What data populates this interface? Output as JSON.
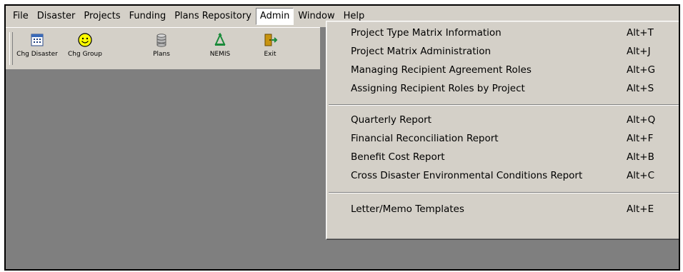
{
  "menubar": {
    "items": [
      "File",
      "Disaster",
      "Projects",
      "Funding",
      "Plans Repository",
      "Admin",
      "Window",
      "Help"
    ],
    "active": "Admin"
  },
  "toolbar": {
    "buttons": [
      {
        "label": "Chg Disaster",
        "icon": "calendar-grid-icon"
      },
      {
        "label": "Chg Group",
        "icon": "smiley-face-icon"
      },
      {
        "label": "Plans",
        "icon": "database-cylinder-icon"
      },
      {
        "label": "NEMIS",
        "icon": "recycle-arrows-icon"
      },
      {
        "label": "Exit",
        "icon": "exit-door-icon"
      }
    ]
  },
  "admin_menu": {
    "groups": [
      [
        {
          "label": "Project Type Matrix Information",
          "shortcut": "Alt+T"
        },
        {
          "label": "Project Matrix Administration",
          "shortcut": "Alt+J"
        },
        {
          "label": "Managing Recipient Agreement Roles",
          "shortcut": "Alt+G"
        },
        {
          "label": "Assigning Recipient Roles by Project",
          "shortcut": "Alt+S"
        }
      ],
      [
        {
          "label": "Quarterly Report",
          "shortcut": "Alt+Q"
        },
        {
          "label": "Financial Reconciliation Report",
          "shortcut": "Alt+F"
        },
        {
          "label": "Benefit Cost Report",
          "shortcut": "Alt+B"
        },
        {
          "label": "Cross Disaster Environmental Conditions Report",
          "shortcut": "Alt+C"
        }
      ],
      [
        {
          "label": "Letter/Memo Templates",
          "shortcut": "Alt+E"
        }
      ]
    ]
  },
  "colors": {
    "chrome": "#d4d0c8",
    "workspace": "#7f7f7f",
    "menu_active_bg": "#ffffff"
  }
}
